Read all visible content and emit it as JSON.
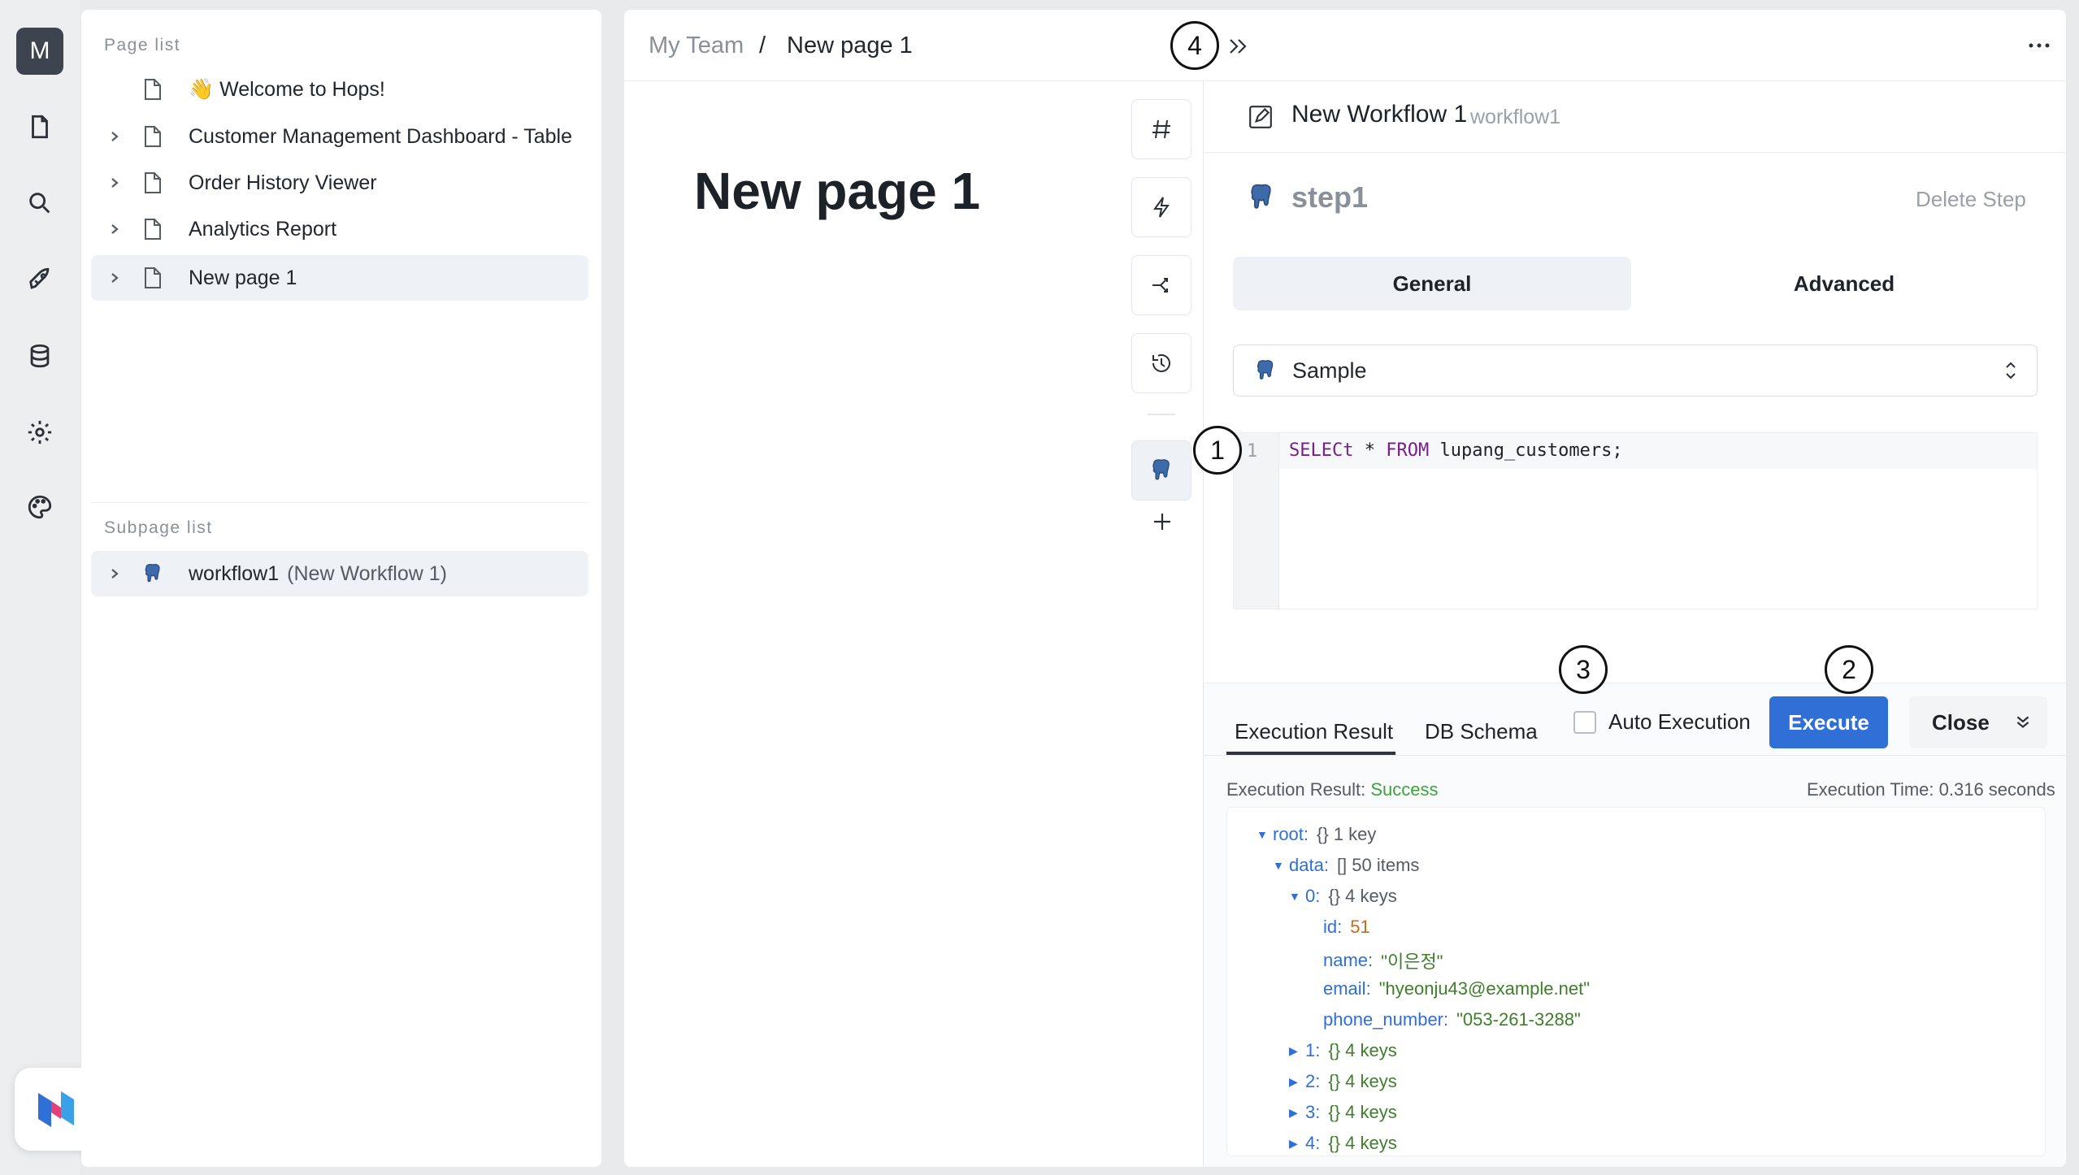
{
  "rail": {
    "avatar_letter": "M",
    "icons": [
      "file-icon",
      "search-icon",
      "rocket-icon",
      "database-icon",
      "settings-icon",
      "palette-icon"
    ]
  },
  "page_list": {
    "title": "Page list",
    "items": [
      {
        "label": "👋 Welcome to Hops!",
        "has_children": false,
        "active": false
      },
      {
        "label": "Customer Management Dashboard - Table",
        "has_children": true,
        "active": false
      },
      {
        "label": "Order History Viewer",
        "has_children": true,
        "active": false
      },
      {
        "label": "Analytics Report",
        "has_children": true,
        "active": false
      },
      {
        "label": "New page 1",
        "has_children": true,
        "active": true
      }
    ]
  },
  "subpage_list": {
    "title": "Subpage list",
    "items": [
      {
        "label": "workflow1",
        "detail": "(New Workflow 1)"
      }
    ]
  },
  "breadcrumb": {
    "team": "My Team",
    "separator": "/",
    "page": "New page 1"
  },
  "page": {
    "heading": "New page 1"
  },
  "badges": {
    "b1": "1",
    "b2": "2",
    "b3": "3",
    "b4": "4"
  },
  "workflow": {
    "title": "New Workflow 1",
    "id": "workflow1",
    "step_name": "step1",
    "delete_label": "Delete Step",
    "tab_general": "General",
    "tab_advanced": "Advanced",
    "datasource": "Sample",
    "editor": {
      "line_number": "1",
      "kw1": "SELECt",
      "star": " * ",
      "kw2": "FROM",
      "rest": " lupang_customers;"
    }
  },
  "result": {
    "tab_execution": "Execution Result",
    "tab_schema": "DB Schema",
    "auto_execution": "Auto Execution",
    "execute_label": "Execute",
    "close_label": "Close",
    "status_prefix": "Execution Result: ",
    "status": "Success",
    "time": "Execution Time: 0.316 seconds",
    "tree": {
      "root_key": "root:",
      "root_meta": "{} 1 key",
      "data_key": "data:",
      "data_meta": "[] 50 items",
      "item0_key": "0:",
      "item0_meta": "{} 4 keys",
      "id_key": "id:",
      "id_val": "51",
      "name_key": "name:",
      "name_val": "\"이은정\"",
      "email_key": "email:",
      "email_val": "\"hyeonju43@example.net\"",
      "phone_key": "phone_number:",
      "phone_val": "\"053-261-3288\"",
      "collapsed": [
        {
          "key": "1:",
          "meta": "{} 4 keys"
        },
        {
          "key": "2:",
          "meta": "{} 4 keys"
        },
        {
          "key": "3:",
          "meta": "{} 4 keys"
        },
        {
          "key": "4:",
          "meta": "{} 4 keys"
        }
      ]
    }
  },
  "colors": {
    "accent": "#2f6fd6",
    "success": "#3ea23e",
    "string": "#3e7f2a",
    "number": "#c46b1a",
    "keyword": "#7a1f8a"
  }
}
